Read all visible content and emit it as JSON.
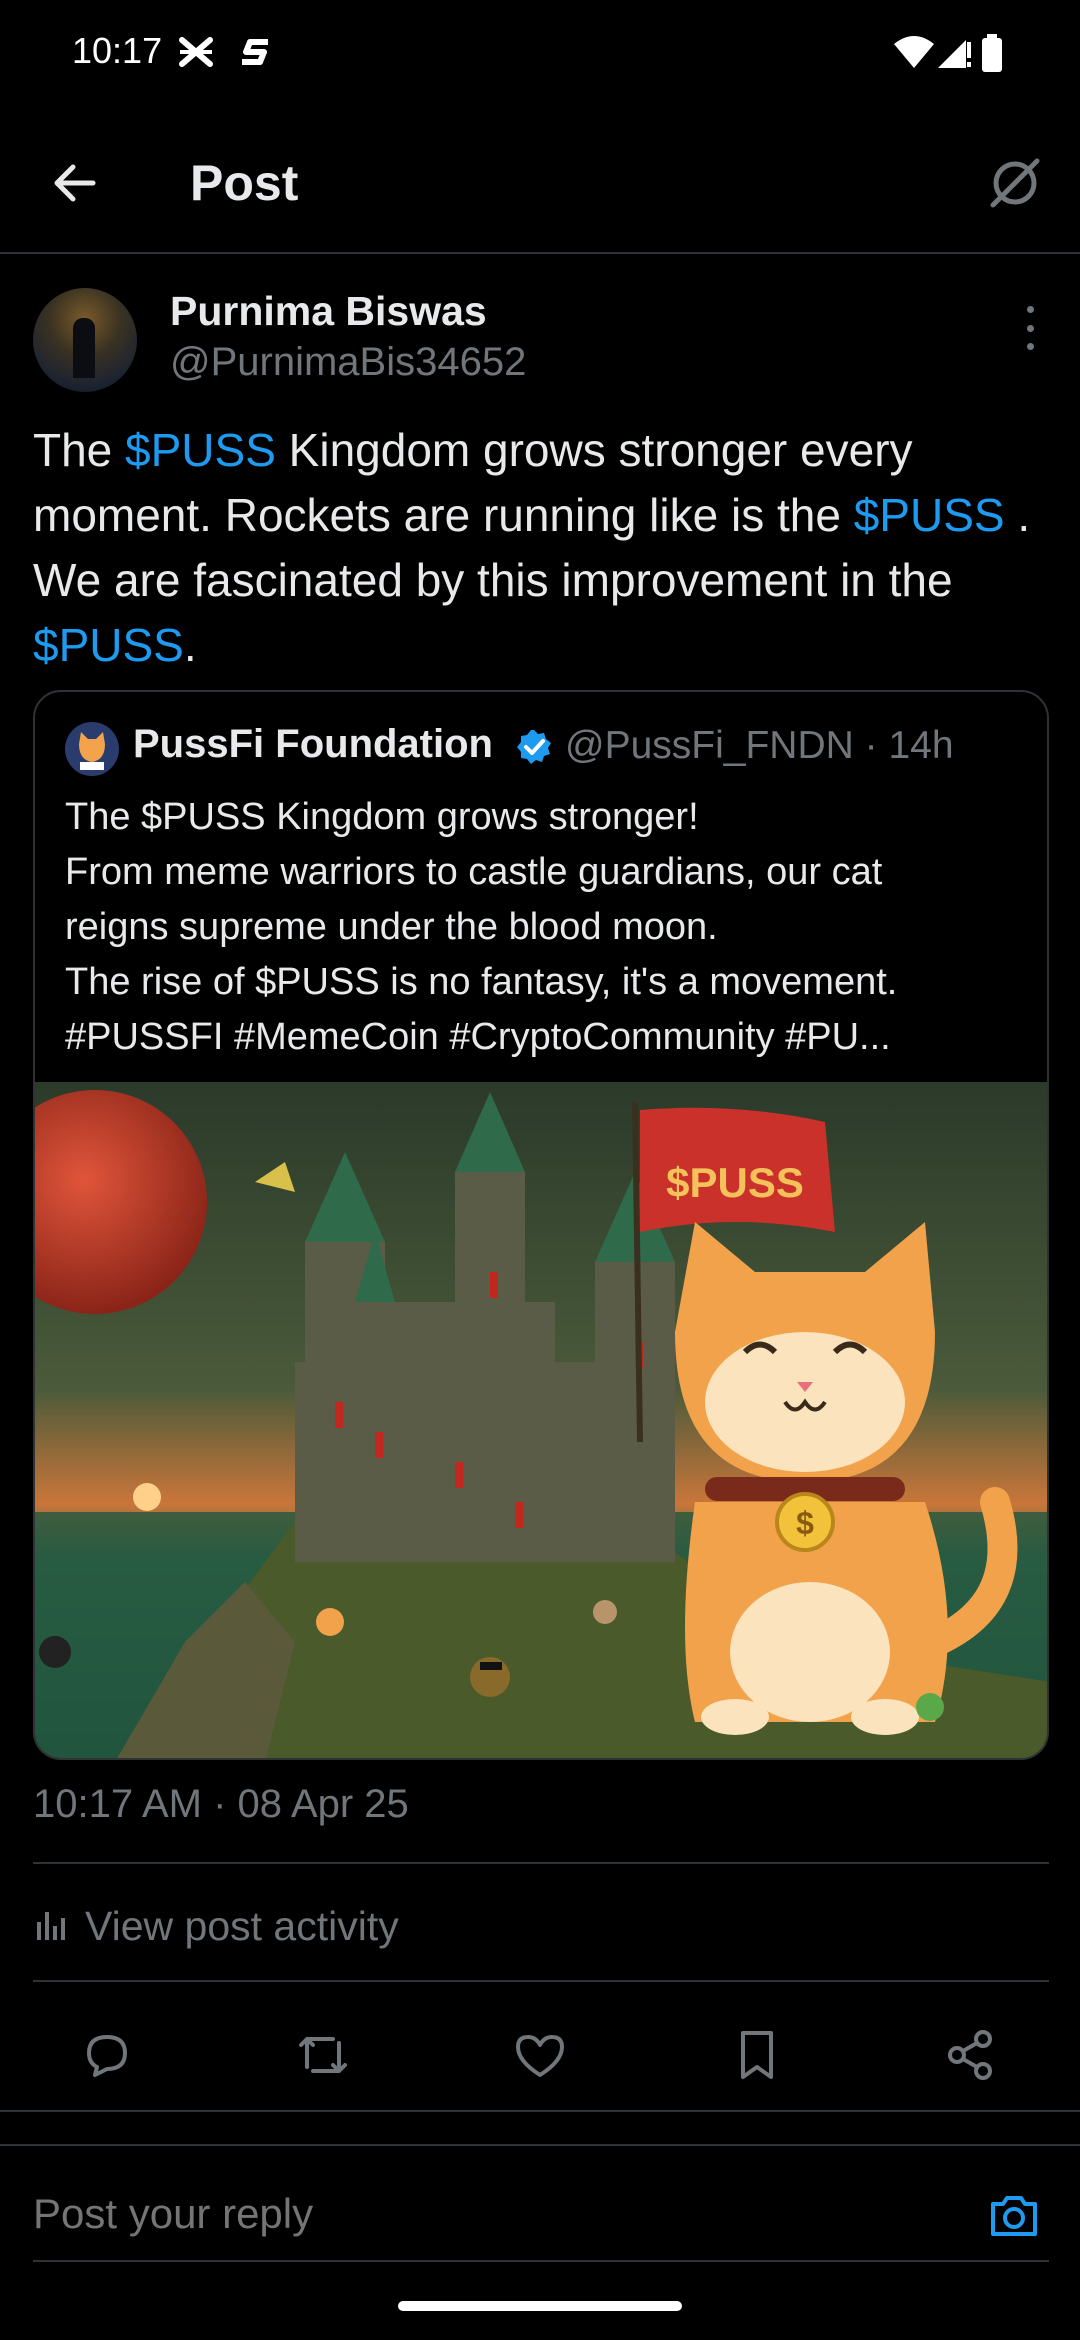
{
  "status_bar": {
    "time": "10:17"
  },
  "header": {
    "title": "Post"
  },
  "post": {
    "author_name": "Purnima Biswas",
    "author_handle": "@PurnimaBis34652",
    "text_parts": [
      "The ",
      "$PUSS",
      " Kingdom grows stronger every moment.  Rockets are running like is the ",
      "$PUSS",
      " . We are fascinated by this improvement in the ",
      "$PUSS",
      "."
    ],
    "timestamp": "10:17 AM · 08 Apr 25",
    "activity_label": "View post activity"
  },
  "quoted_post": {
    "author_name": "PussFi Foundation",
    "author_handle": "@PussFi_FNDN · 14h",
    "lines": [
      "The $PUSS Kingdom grows stronger!",
      "From meme warriors to castle guardians, our cat",
      "reigns supreme under the blood moon.",
      "The rise of $PUSS is no fantasy,  it's a movement.",
      "#PUSSFI #MemeCoin #CryptoCommunity #PU..."
    ],
    "media": {
      "flag_text": "$PUSS",
      "coin_symbol": "$"
    }
  },
  "reply": {
    "placeholder": "Post your reply"
  },
  "colors": {
    "accent": "#1d9bf0",
    "muted": "#71767b",
    "border": "#2f3336"
  },
  "icons": [
    "back-arrow-icon",
    "grok-icon",
    "more-icon",
    "verified-icon",
    "analytics-icon",
    "reply-icon",
    "repost-icon",
    "like-icon",
    "bookmark-icon",
    "share-icon",
    "camera-icon"
  ]
}
